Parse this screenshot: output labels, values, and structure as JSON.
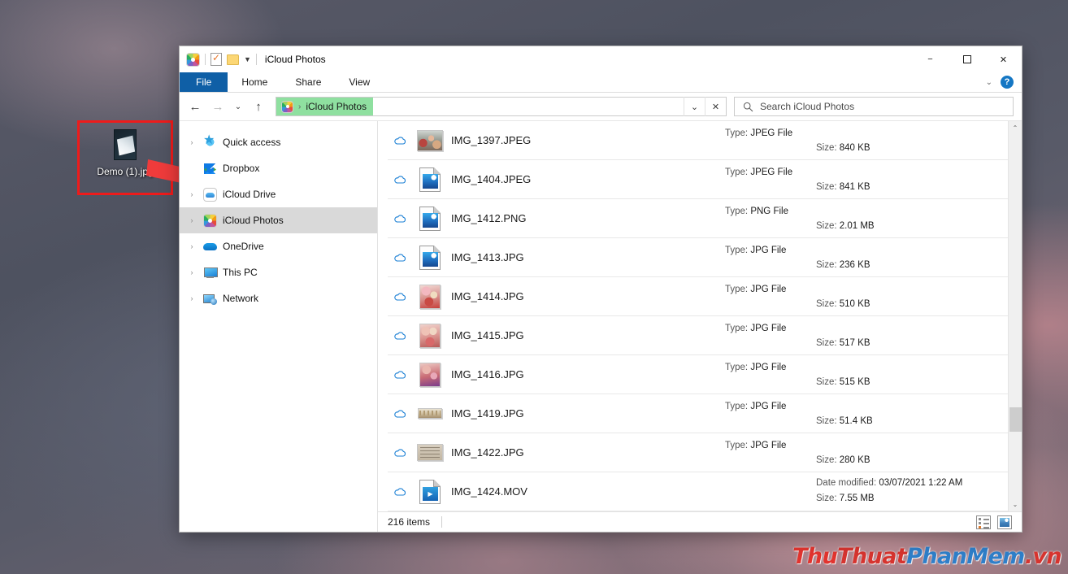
{
  "desktop": {
    "icon": {
      "label": "Demo (1).jpg",
      "name": "desktop-file-icon"
    },
    "watermark": [
      {
        "text": "Thu",
        "color": "#e2342f"
      },
      {
        "text": "Thuat",
        "color": "#d6342f"
      },
      {
        "text": "Phan",
        "color": "#2f7fc9"
      },
      {
        "text": "Mem",
        "color": "#2f7fc9"
      },
      {
        "text": ".vn",
        "color": "#d6342f"
      }
    ],
    "annotation": {
      "box_color": "#ee1b1b",
      "arrow_color": "#ef3b3b"
    }
  },
  "window": {
    "title": "iCloud Photos",
    "quick_access": {
      "app_icon": "icloud-photos-icon",
      "properties_icon": "properties-icon",
      "new_folder_icon": "new-folder-icon",
      "customize_caret": "chevron-down-icon"
    },
    "controls": {
      "minimize": "−",
      "maximize": "❑",
      "close": "✕"
    }
  },
  "ribbon": {
    "tabs": [
      {
        "label": "File",
        "active": true
      },
      {
        "label": "Home",
        "active": false
      },
      {
        "label": "Share",
        "active": false
      },
      {
        "label": "View",
        "active": false
      }
    ],
    "collapse_icon": "chevron-down-icon",
    "help_icon": "help-icon",
    "help_label": "?"
  },
  "addressbar": {
    "back_icon": "back-arrow-icon",
    "forward_icon": "forward-arrow-icon",
    "recent_icon": "recent-locations-icon",
    "up_icon": "up-arrow-icon",
    "breadcrumb": {
      "icon": "icloud-photos-icon",
      "separator": "›",
      "label": "iCloud Photos",
      "highlight_color": "#8fe0a0"
    },
    "dropdown_icon": "chevron-down-icon",
    "refresh_close_icon": "✕",
    "search": {
      "icon": "search-icon",
      "placeholder": "Search iCloud Photos",
      "value": ""
    }
  },
  "navpane": {
    "items": [
      {
        "label": "Quick access",
        "icon": "quick-access-icon",
        "chevron": true,
        "selected": false
      },
      {
        "label": "Dropbox",
        "icon": "dropbox-icon",
        "chevron": false,
        "selected": false
      },
      {
        "label": "iCloud Drive",
        "icon": "icloud-drive-icon",
        "chevron": true,
        "selected": false
      },
      {
        "label": "iCloud Photos",
        "icon": "icloud-photos-icon",
        "chevron": true,
        "selected": true
      },
      {
        "label": "OneDrive",
        "icon": "onedrive-icon",
        "chevron": true,
        "selected": false
      },
      {
        "label": "This PC",
        "icon": "this-pc-icon",
        "chevron": true,
        "selected": false
      },
      {
        "label": "Network",
        "icon": "network-icon",
        "chevron": true,
        "selected": false
      }
    ]
  },
  "filelist": {
    "labels": {
      "type": "Type:",
      "size": "Size:",
      "date": "Date modified:"
    },
    "status_icon": "cloud-online-only-icon",
    "rows": [
      {
        "name": "IMG_1397.JPEG",
        "type": "JPEG File",
        "size": "840 KB",
        "date": "",
        "thumb": "photo",
        "thumb_class": "t-1397"
      },
      {
        "name": "IMG_1404.JPEG",
        "type": "JPEG File",
        "size": "841 KB",
        "date": "",
        "thumb": "doc",
        "thumb_class": ""
      },
      {
        "name": "IMG_1412.PNG",
        "type": "PNG File",
        "size": "2.01 MB",
        "date": "",
        "thumb": "doc",
        "thumb_class": ""
      },
      {
        "name": "IMG_1413.JPG",
        "type": "JPG File",
        "size": "236 KB",
        "date": "",
        "thumb": "doc",
        "thumb_class": ""
      },
      {
        "name": "IMG_1414.JPG",
        "type": "JPG File",
        "size": "510 KB",
        "date": "",
        "thumb": "photo",
        "thumb_class": "t-1414"
      },
      {
        "name": "IMG_1415.JPG",
        "type": "JPG File",
        "size": "517 KB",
        "date": "",
        "thumb": "photo",
        "thumb_class": "t-1415"
      },
      {
        "name": "IMG_1416.JPG",
        "type": "JPG File",
        "size": "515 KB",
        "date": "",
        "thumb": "photo",
        "thumb_class": "t-1416"
      },
      {
        "name": "IMG_1419.JPG",
        "type": "JPG File",
        "size": "51.4 KB",
        "date": "",
        "thumb": "photo",
        "thumb_class": "t-1419"
      },
      {
        "name": "IMG_1422.JPG",
        "type": "JPG File",
        "size": "280 KB",
        "date": "",
        "thumb": "photo",
        "thumb_class": "t-1422"
      },
      {
        "name": "IMG_1424.MOV",
        "type": "",
        "size": "7.55 MB",
        "date": "03/07/2021 1:22 AM",
        "thumb": "mov",
        "thumb_class": ""
      }
    ],
    "scrollbar": {
      "up_icon": "▲",
      "down_icon": "▼"
    }
  },
  "statusbar": {
    "item_count": "216 items",
    "views": [
      {
        "name": "details-view-button",
        "label": "Details view"
      },
      {
        "name": "large-icons-view-button",
        "label": "Large icons view"
      }
    ]
  }
}
